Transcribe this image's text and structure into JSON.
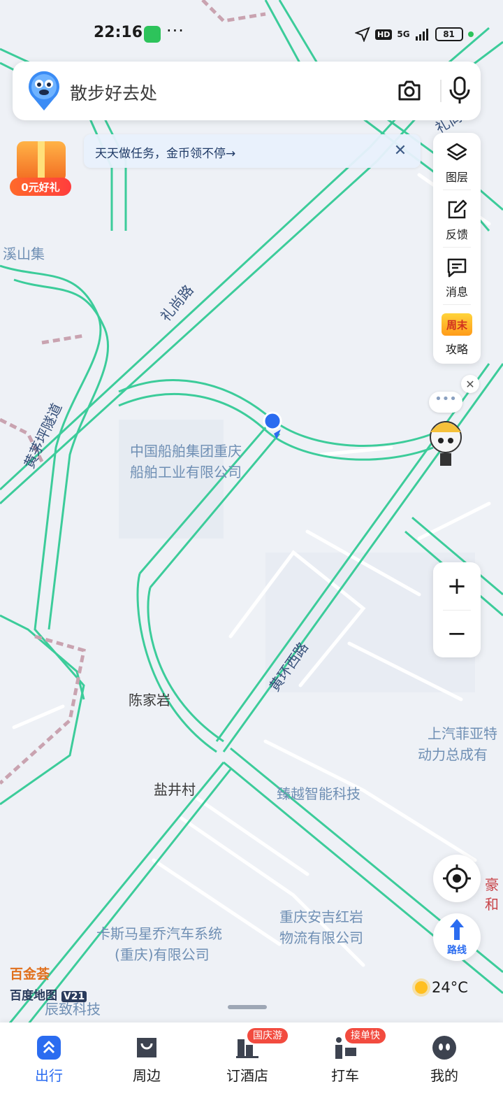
{
  "status_bar": {
    "time": "22:16",
    "dots": "···",
    "network": "5G",
    "hd": "HD",
    "battery": "81"
  },
  "search": {
    "placeholder": "散步好去处"
  },
  "gift": {
    "label": "0元好礼"
  },
  "task_banner": {
    "text": "天天做任务，金币领不停→"
  },
  "tools": [
    {
      "label": "图层",
      "icon": "layers-icon"
    },
    {
      "label": "反馈",
      "icon": "edit-feedback-icon"
    },
    {
      "label": "消息",
      "icon": "message-icon"
    },
    {
      "label": "攻略",
      "icon": "weekend-badge-icon",
      "badge_text": "周末"
    }
  ],
  "route": {
    "label": "路线"
  },
  "map_labels": {
    "poi_shipbuilding_1": "中国船舶集团重庆",
    "poi_shipbuilding_2": "船舶工业有限公司",
    "poi_xishan": "溪山集",
    "poi_chenjiayan": "陈家岩",
    "poi_yanjingcun": "盐井村",
    "poi_zhenyue": "臻越智能科技",
    "poi_saic_1": "上汽菲亚特",
    "poi_saic_2": "动力总成有",
    "poi_anji_1": "重庆安吉红岩",
    "poi_anji_2": "物流有限公司",
    "poi_kasima_1": "卡斯马星乔汽车系统",
    "poi_kasima_2": "(重庆)有限公司",
    "poi_chenzhi": "辰致科技",
    "poi_hao": "豪",
    "poi_he": "和",
    "road_lishang": "礼尚路",
    "road_huangmaoping": "黄茅坪隧道",
    "road_huanghuan_west": "黄环西路",
    "road_li_tunnel": "礼尚隧"
  },
  "brand": {
    "line1": "百金荟",
    "line2": "百度地图",
    "version": "V21"
  },
  "weather": {
    "temp": "24°C"
  },
  "nav": [
    {
      "label": "出行",
      "active": true,
      "icon": "travel-icon"
    },
    {
      "label": "周边",
      "active": false,
      "icon": "nearby-bag-icon"
    },
    {
      "label": "订酒店",
      "active": false,
      "icon": "hotel-icon",
      "badge": "国庆游"
    },
    {
      "label": "打车",
      "active": false,
      "icon": "taxi-icon",
      "badge": "接单快"
    },
    {
      "label": "我的",
      "active": false,
      "icon": "profile-icon"
    }
  ],
  "colors": {
    "road_green": "#3ccc9a",
    "accent_blue": "#2b6cf0",
    "map_bg": "#eef1f6"
  }
}
